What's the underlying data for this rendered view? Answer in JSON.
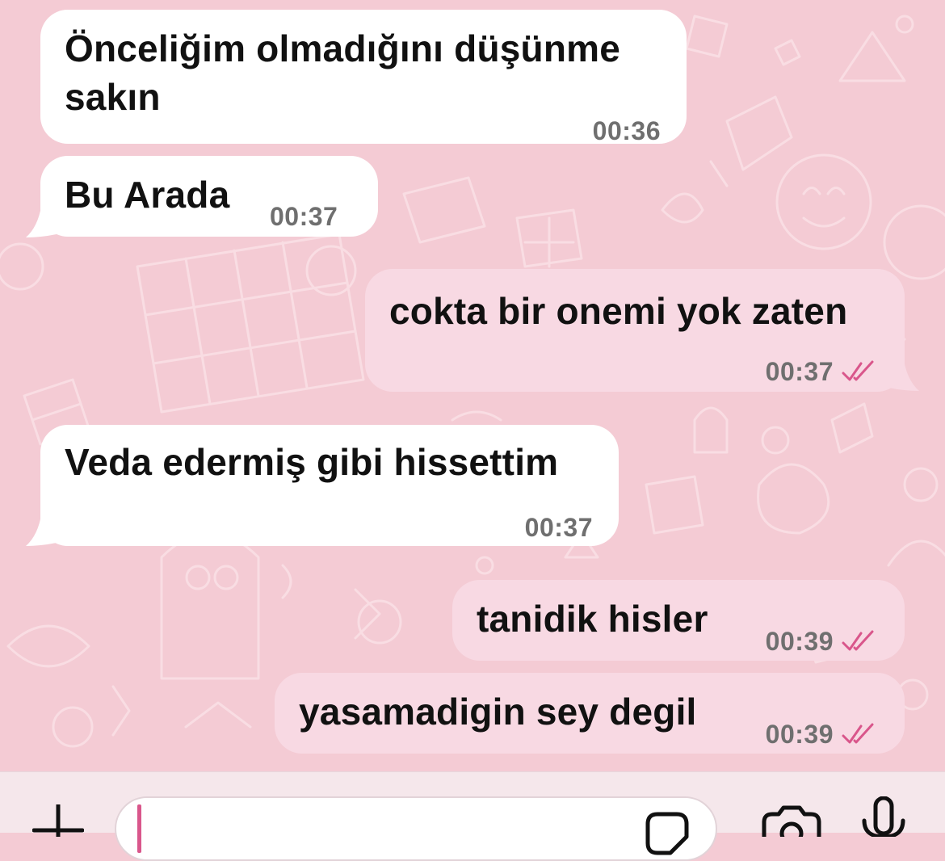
{
  "messages": [
    {
      "id": "m1",
      "direction": "incoming",
      "text": "Önceliğim olmadığını düşünme\nsakın",
      "time": "00:36"
    },
    {
      "id": "m2",
      "direction": "incoming",
      "text": "Bu Arada",
      "time": "00:37"
    },
    {
      "id": "m3",
      "direction": "outgoing",
      "text": "cokta bir onemi yok zaten",
      "time": "00:37",
      "status": "read"
    },
    {
      "id": "m4",
      "direction": "incoming",
      "text": "Veda edermiş gibi hissettim",
      "time": "00:37"
    },
    {
      "id": "m5",
      "direction": "outgoing",
      "text": "tanidik hisler",
      "time": "00:39",
      "status": "read"
    },
    {
      "id": "m6",
      "direction": "outgoing",
      "text": "yasamadigin sey degil",
      "time": "00:39",
      "status": "read"
    }
  ],
  "composer": {
    "input_value": "",
    "icons": [
      "plus-icon",
      "sticker-icon",
      "camera-icon",
      "microphone-icon"
    ]
  },
  "colors": {
    "wallpaper": "#f4cbd4",
    "incoming_bubble": "#ffffff",
    "outgoing_bubble": "#f8d9e3",
    "read_ticks": "#d9568b",
    "timestamp": "#6f6f6f"
  }
}
